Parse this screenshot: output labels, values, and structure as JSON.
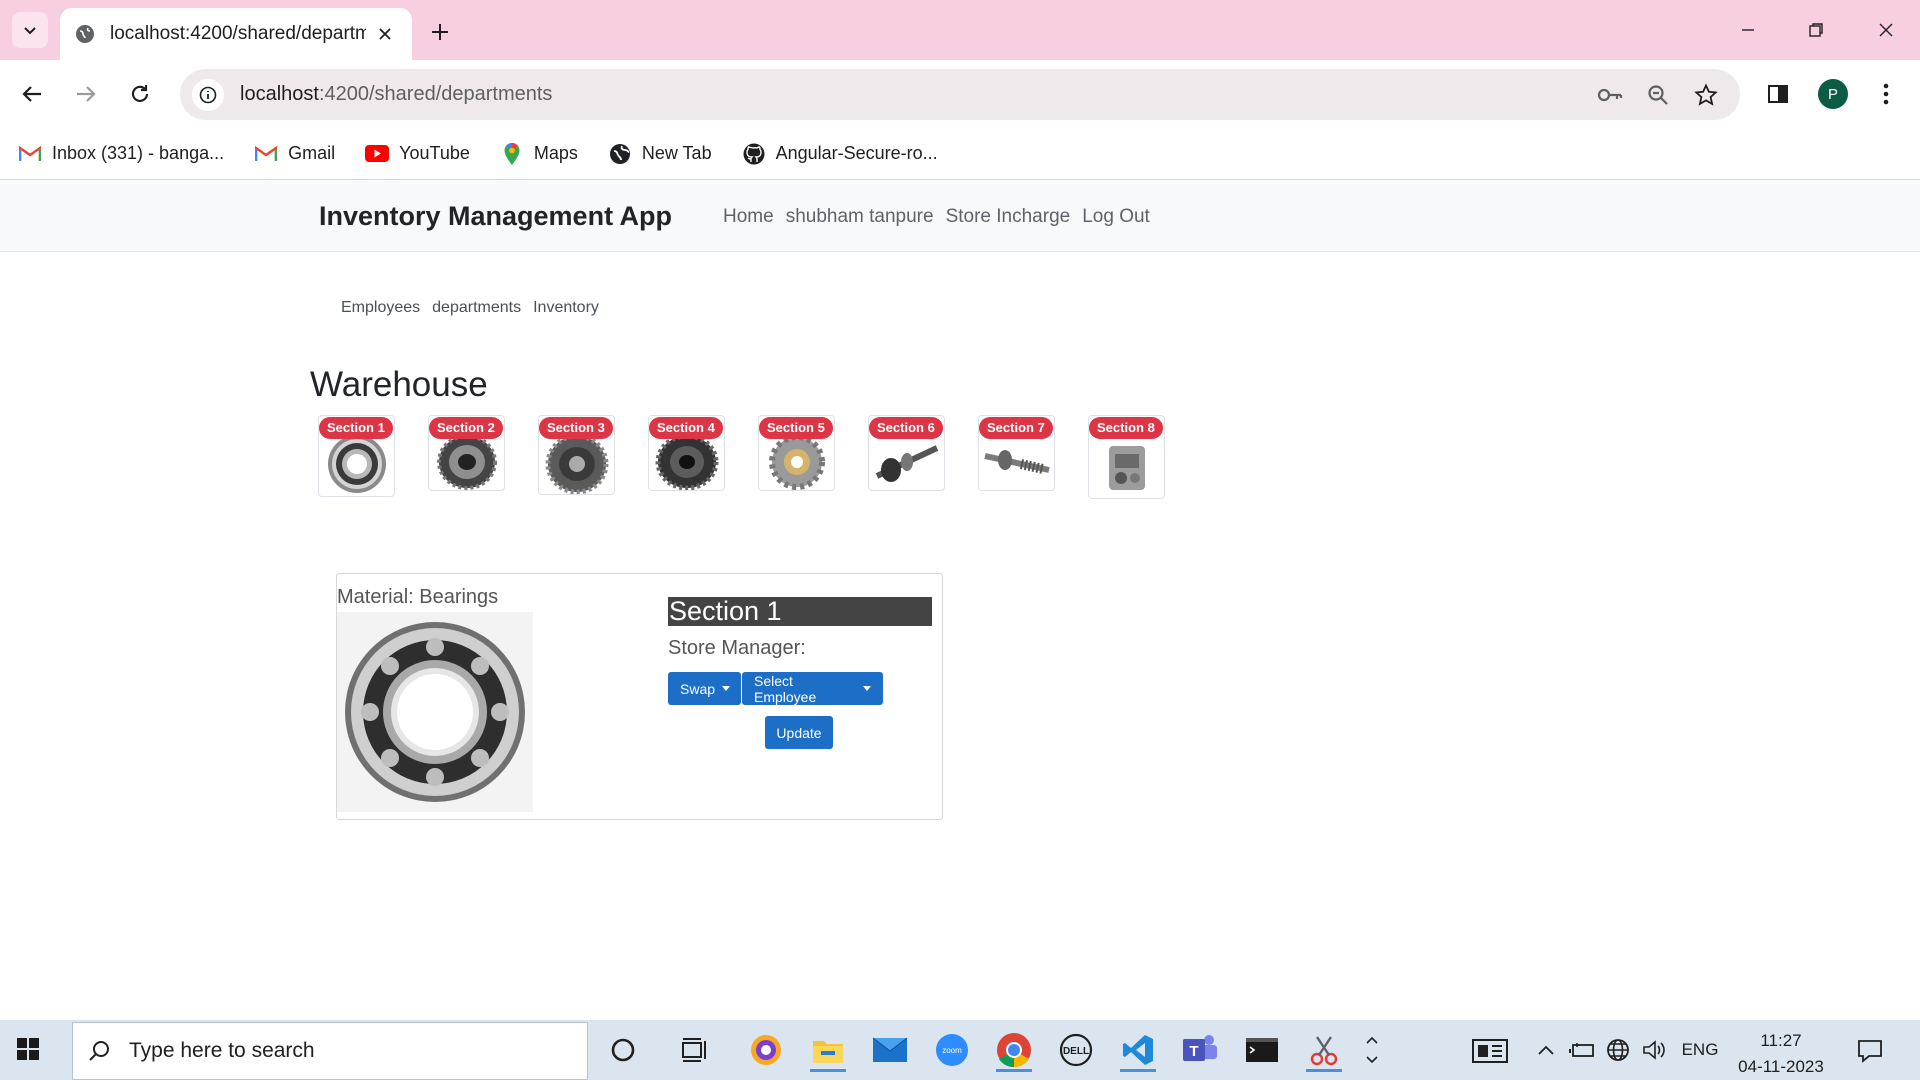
{
  "browser": {
    "tab_title": "localhost:4200/shared/departm",
    "url_host": "localhost",
    "url_path": ":4200/shared/departments",
    "profile_initial": "P",
    "bookmarks": [
      {
        "label": "Inbox (331) - banga...",
        "icon": "gmail-icon"
      },
      {
        "label": "Gmail",
        "icon": "gmail-icon"
      },
      {
        "label": "YouTube",
        "icon": "youtube-icon"
      },
      {
        "label": "Maps",
        "icon": "maps-icon"
      },
      {
        "label": "New Tab",
        "icon": "globe-icon"
      },
      {
        "label": "Angular-Secure-ro...",
        "icon": "github-icon"
      }
    ]
  },
  "app": {
    "brand": "Inventory Management App",
    "nav": [
      "Home",
      "shubham tanpure",
      "Store Incharge",
      "Log Out"
    ],
    "subnav": [
      "Employees",
      "departments",
      "Inventory"
    ],
    "warehouse_title": "Warehouse",
    "sections": [
      {
        "badge": "Section 1",
        "part": "bearing"
      },
      {
        "badge": "Section 2",
        "part": "gear"
      },
      {
        "badge": "Section 3",
        "part": "gear"
      },
      {
        "badge": "Section 4",
        "part": "gear"
      },
      {
        "badge": "Section 5",
        "part": "sprocket"
      },
      {
        "badge": "Section 6",
        "part": "shaft"
      },
      {
        "badge": "Section 7",
        "part": "shaft"
      },
      {
        "badge": "Section 8",
        "part": "gearbox"
      }
    ],
    "detail": {
      "material": "Material: Bearings",
      "section_title": "Section 1",
      "store_manager": "Store Manager:",
      "swap_label": "Swap",
      "select_employee_label": "Select Employee",
      "update_label": "Update"
    }
  },
  "taskbar": {
    "search_placeholder": "Type here to search",
    "language": "ENG",
    "time": "11:27",
    "date": "04-11-2023"
  },
  "colors": {
    "badge": "#dc3545",
    "primary_button": "#1c6ec7",
    "tabstrip": "#f7cfe0"
  }
}
